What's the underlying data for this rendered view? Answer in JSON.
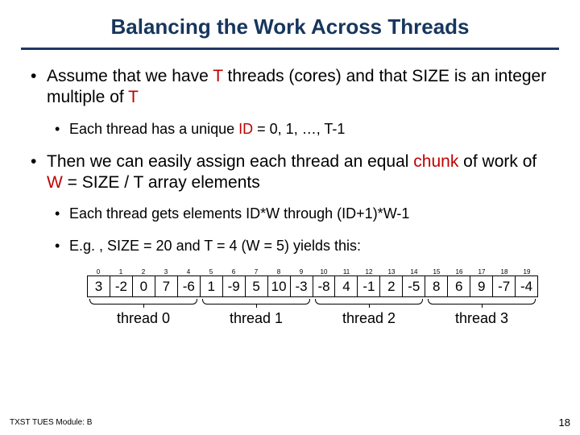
{
  "title": "Balancing the Work Across Threads",
  "bullets": {
    "b1_pre": "Assume that we have ",
    "b1_T": "T",
    "b1_mid": " threads (cores) and that SIZE is an integer multiple of ",
    "b1_T2": "T",
    "b1a_pre": "Each thread has a unique ",
    "b1a_ID": "ID",
    "b1a_post": " = 0, 1, …, T-1",
    "b2_pre": "Then we can easily assign each thread an equal ",
    "b2_chunk": "chunk",
    "b2_mid": " of work of ",
    "b2_W": "W",
    "b2_post": " = SIZE / T array elements",
    "b2a": "Each thread gets elements ID*W through (ID+1)*W-1",
    "b2b": "E.g. , SIZE = 20 and T = 4 (W = 5) yields this:"
  },
  "array": {
    "indices": [
      "0",
      "1",
      "2",
      "3",
      "4",
      "5",
      "6",
      "7",
      "8",
      "9",
      "10",
      "11",
      "12",
      "13",
      "14",
      "15",
      "16",
      "17",
      "18",
      "19"
    ],
    "values": [
      "3",
      "-2",
      "0",
      "7",
      "-6",
      "1",
      "-9",
      "5",
      "10",
      "-3",
      "-8",
      "4",
      "-1",
      "2",
      "-5",
      "8",
      "6",
      "9",
      "-7",
      "-4"
    ],
    "labels": [
      "thread 0",
      "thread 1",
      "thread 2",
      "thread 3"
    ]
  },
  "footer": {
    "left": "TXST TUES Module: B",
    "right": "18"
  },
  "chart_data": {
    "type": "table",
    "title": "Array of SIZE=20 partitioned across T=4 threads (W=5)",
    "indices": [
      0,
      1,
      2,
      3,
      4,
      5,
      6,
      7,
      8,
      9,
      10,
      11,
      12,
      13,
      14,
      15,
      16,
      17,
      18,
      19
    ],
    "values": [
      3,
      -2,
      0,
      7,
      -6,
      1,
      -9,
      5,
      10,
      -3,
      -8,
      4,
      -1,
      2,
      -5,
      8,
      6,
      9,
      -7,
      -4
    ],
    "partitions": [
      {
        "name": "thread 0",
        "range": [
          0,
          4
        ]
      },
      {
        "name": "thread 1",
        "range": [
          5,
          9
        ]
      },
      {
        "name": "thread 2",
        "range": [
          10,
          14
        ]
      },
      {
        "name": "thread 3",
        "range": [
          15,
          19
        ]
      }
    ]
  }
}
